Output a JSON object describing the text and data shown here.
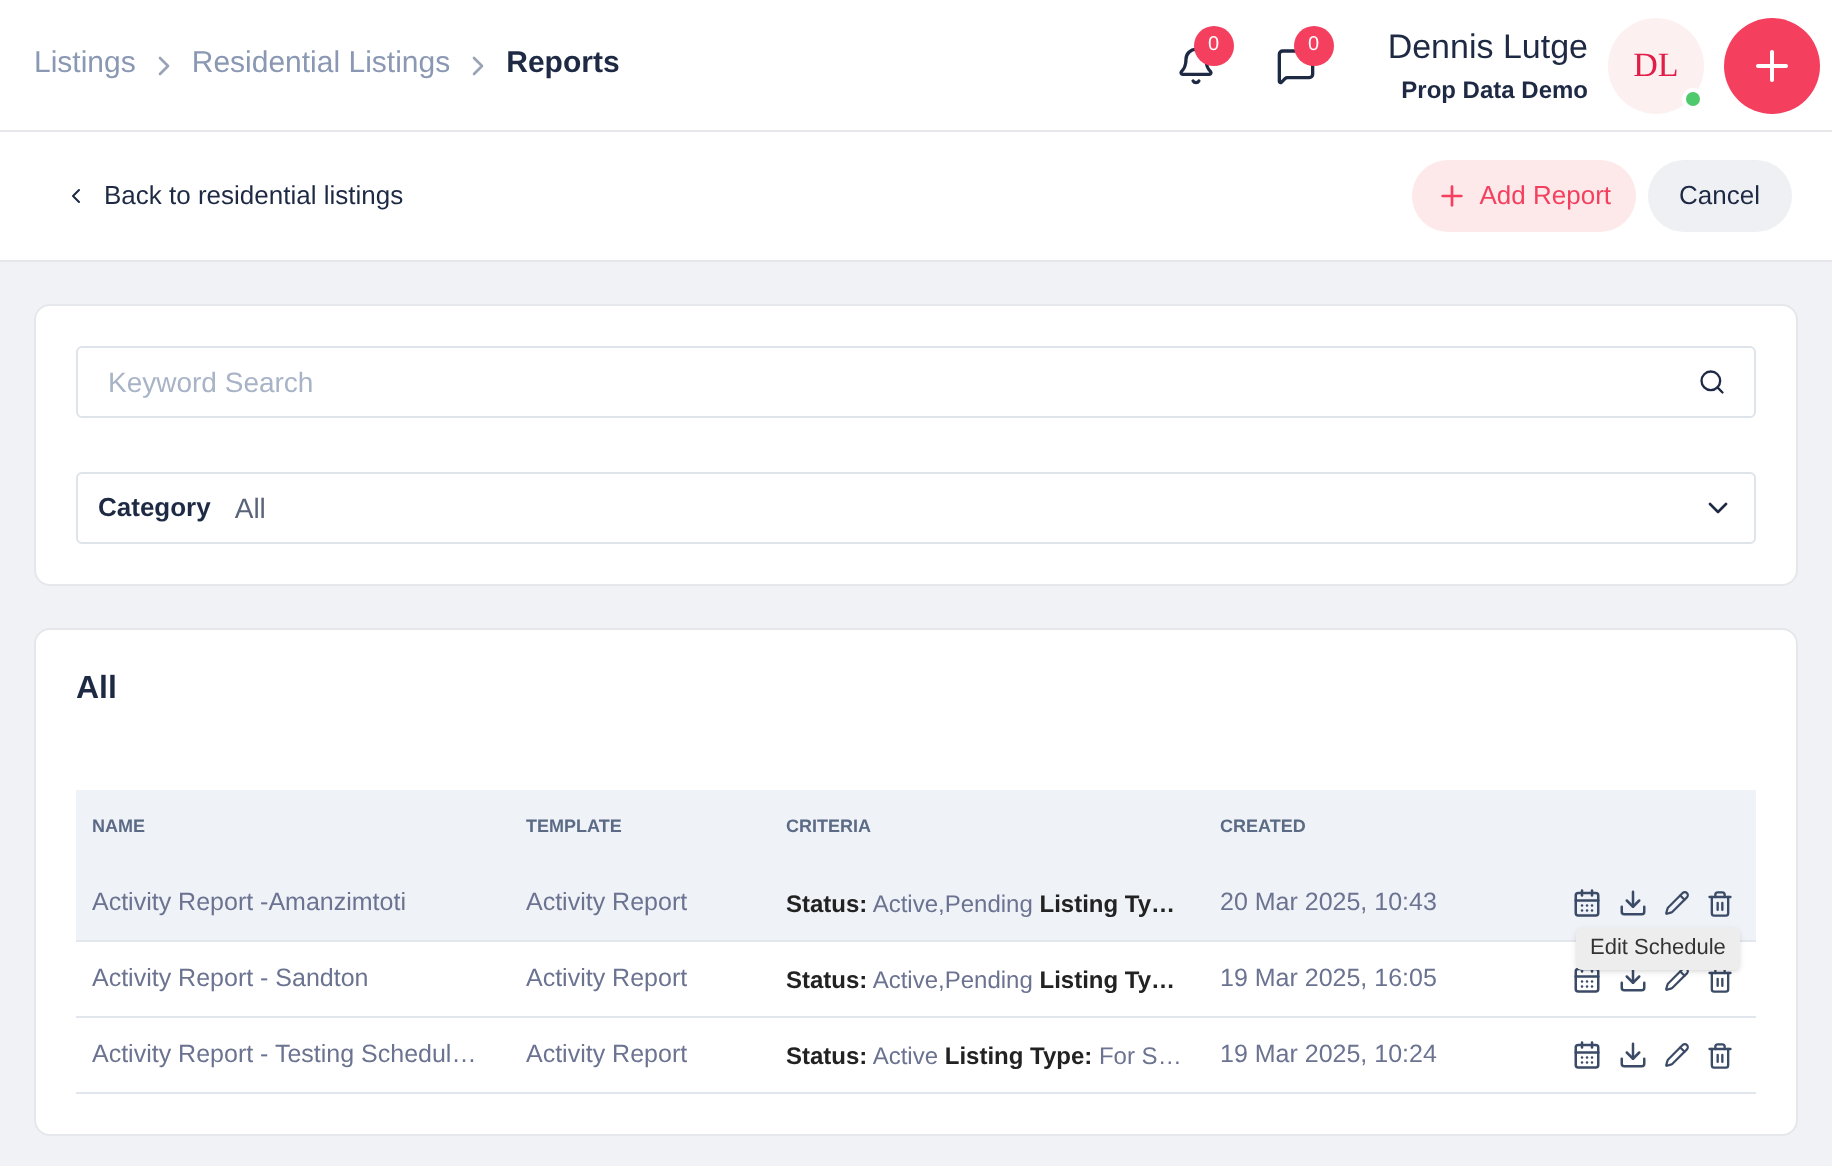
{
  "breadcrumbs": [
    {
      "label": "Listings",
      "current": false
    },
    {
      "label": "Residential Listings",
      "current": false
    },
    {
      "label": "Reports",
      "current": true
    }
  ],
  "notifications": {
    "count": "0"
  },
  "messages": {
    "count": "0"
  },
  "user": {
    "name": "Dennis Lutge",
    "company": "Prop Data Demo",
    "initials": "DL",
    "online": true
  },
  "back_link": "Back to residential listings",
  "buttons": {
    "add": "Add Report",
    "cancel": "Cancel"
  },
  "search": {
    "placeholder": "Keyword Search"
  },
  "category": {
    "label": "Category",
    "value": "All"
  },
  "table": {
    "title": "All",
    "columns": [
      "NAME",
      "TEMPLATE",
      "CRITERIA",
      "CREATED"
    ],
    "rows": [
      {
        "name": "Activity Report -Amanzimtoti",
        "template": "Activity Report",
        "criteria": "**Status:** Active,Pending **Listing Ty…**",
        "created": "20 Mar 2025, 10:43",
        "hovered": true
      },
      {
        "name": "Activity Report - Sandton",
        "template": "Activity Report",
        "criteria": "**Status:** Active,Pending **Listing Ty…**",
        "created": "19 Mar 2025, 16:05",
        "hovered": false
      },
      {
        "name": "Activity Report - Testing Schedul…",
        "template": "Activity Report",
        "criteria": "**Status:** Active **Listing Type:** For S…",
        "created": "19 Mar 2025, 10:24",
        "hovered": false
      }
    ]
  },
  "tooltip": "Edit Schedule"
}
